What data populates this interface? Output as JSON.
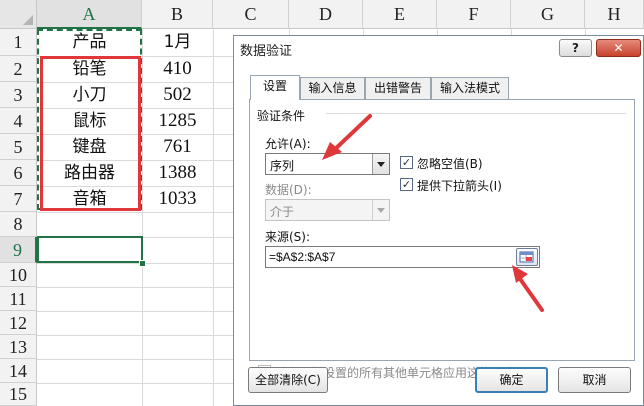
{
  "sheet": {
    "columns": [
      "A",
      "B",
      "C",
      "D",
      "E",
      "F",
      "G",
      "H"
    ],
    "rows": [
      "1",
      "2",
      "3",
      "4",
      "5",
      "6",
      "7",
      "8",
      "9",
      "10",
      "11",
      "12",
      "13",
      "14",
      "15"
    ],
    "col_a": [
      "产品",
      "铅笔",
      "小刀",
      "鼠标",
      "键盘",
      "路由器",
      "音箱"
    ],
    "col_b": [
      "1月",
      "410",
      "502",
      "1285",
      "761",
      "1388",
      "1033"
    ]
  },
  "dialog": {
    "title": "数据验证",
    "help_label": "?",
    "close_label": "✕",
    "tabs": [
      "设置",
      "输入信息",
      "出错警告",
      "输入法模式"
    ],
    "group_label": "验证条件",
    "allow_label": "允许(A):",
    "allow_value": "序列",
    "ignore_blank_label": "忽略空值(B)",
    "dropdown_label": "提供下拉箭头(I)",
    "data_label": "数据(D):",
    "data_value": "介于",
    "source_label": "来源(S):",
    "source_value": "=$A$2:$A$7",
    "apply_all_label": "对有同样设置的所有其他单元格应用这些更改(P)",
    "clear_all_label": "全部清除(C)",
    "ok_label": "确定",
    "cancel_label": "取消"
  },
  "state": {
    "ignore_blank_checked": true,
    "dropdown_checked": true,
    "apply_all_checked": false,
    "active_tab": "设置",
    "active_cell": "A9"
  },
  "colors": {
    "excel_green": "#217346",
    "annotation_red": "#e0383a",
    "default_button_blue": "#3c7fb1",
    "close_red": "#c7422c"
  },
  "icons": {
    "checkmark": "checkmark-icon",
    "range_picker": "range-picker-icon",
    "dropdown": "chevron-down-icon"
  }
}
